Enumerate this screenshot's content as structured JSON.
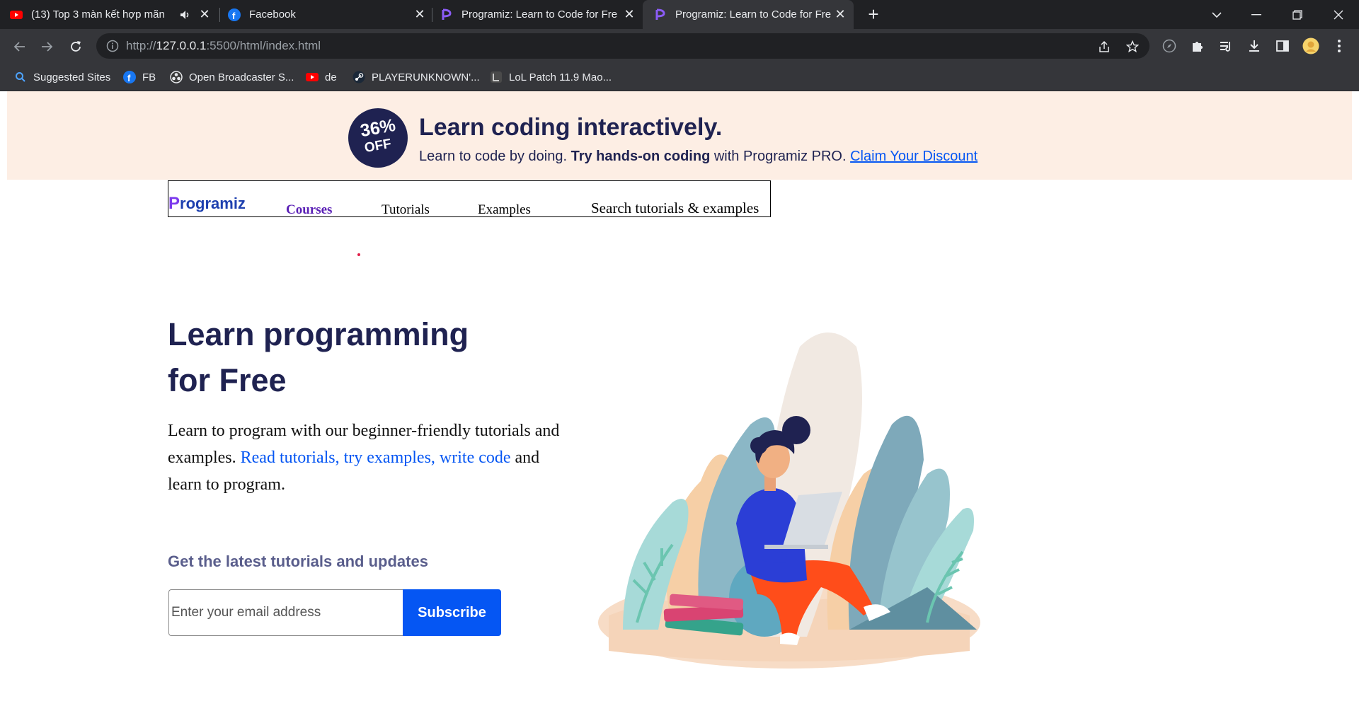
{
  "browser": {
    "tabs": [
      {
        "title": "(13) Top 3 màn kết hợp mãn",
        "favicon": "youtube-icon",
        "muted_icon": "speaker-icon",
        "active": false
      },
      {
        "title": "Facebook",
        "favicon": "facebook-icon",
        "active": false
      },
      {
        "title": "Programiz: Learn to Code for Free",
        "favicon": "programiz-icon",
        "active": false
      },
      {
        "title": "Programiz: Learn to Code for Free",
        "favicon": "programiz-icon",
        "active": true
      }
    ],
    "url_host": "127.0.0.1",
    "url_rest": ":5500/html/index.html",
    "url_prefix": "http://",
    "bookmarks": [
      {
        "label": "Suggested Sites",
        "icon": "search-icon"
      },
      {
        "label": "FB",
        "icon": "facebook-icon"
      },
      {
        "label": "Open Broadcaster S...",
        "icon": "obs-icon"
      },
      {
        "label": "de",
        "icon": "youtube-icon"
      },
      {
        "label": "PLAYERUNKNOWN'...",
        "icon": "steam-icon"
      },
      {
        "label": "LoL Patch 11.9 Mao...",
        "icon": "lol-icon"
      }
    ]
  },
  "banner": {
    "badge_percent": "36%",
    "badge_off": "OFF",
    "title": "Learn coding interactively.",
    "sub_plain": "Learn to code by doing. ",
    "sub_bold": "Try hands-on coding",
    "sub_plain2": " with Programiz PRO. ",
    "sub_link": "Claim Your Discount"
  },
  "nav": {
    "logo": "rogramiz",
    "logo_initial": "P",
    "links": [
      "Courses",
      "Tutorials",
      "Examples"
    ],
    "search_placeholder": "Search tutorials & examples"
  },
  "hero": {
    "title_line1": "Learn programming",
    "title_line2": "for Free",
    "text_plain": "Learn to program with our beginner-friendly tutorials and examples. ",
    "text_link": "Read tutorials, try examples, write code",
    "text_end": " and learn to program.",
    "updates_heading": "Get the latest tutorials and updates",
    "email_placeholder": "Enter your email address",
    "subscribe_label": "Subscribe"
  },
  "colors": {
    "brand_navy": "#1f2251",
    "brand_blue": "#0556f3",
    "banner_bg": "#fdeee4",
    "chrome_dark": "#202124",
    "chrome_toolbar": "#35363a"
  }
}
